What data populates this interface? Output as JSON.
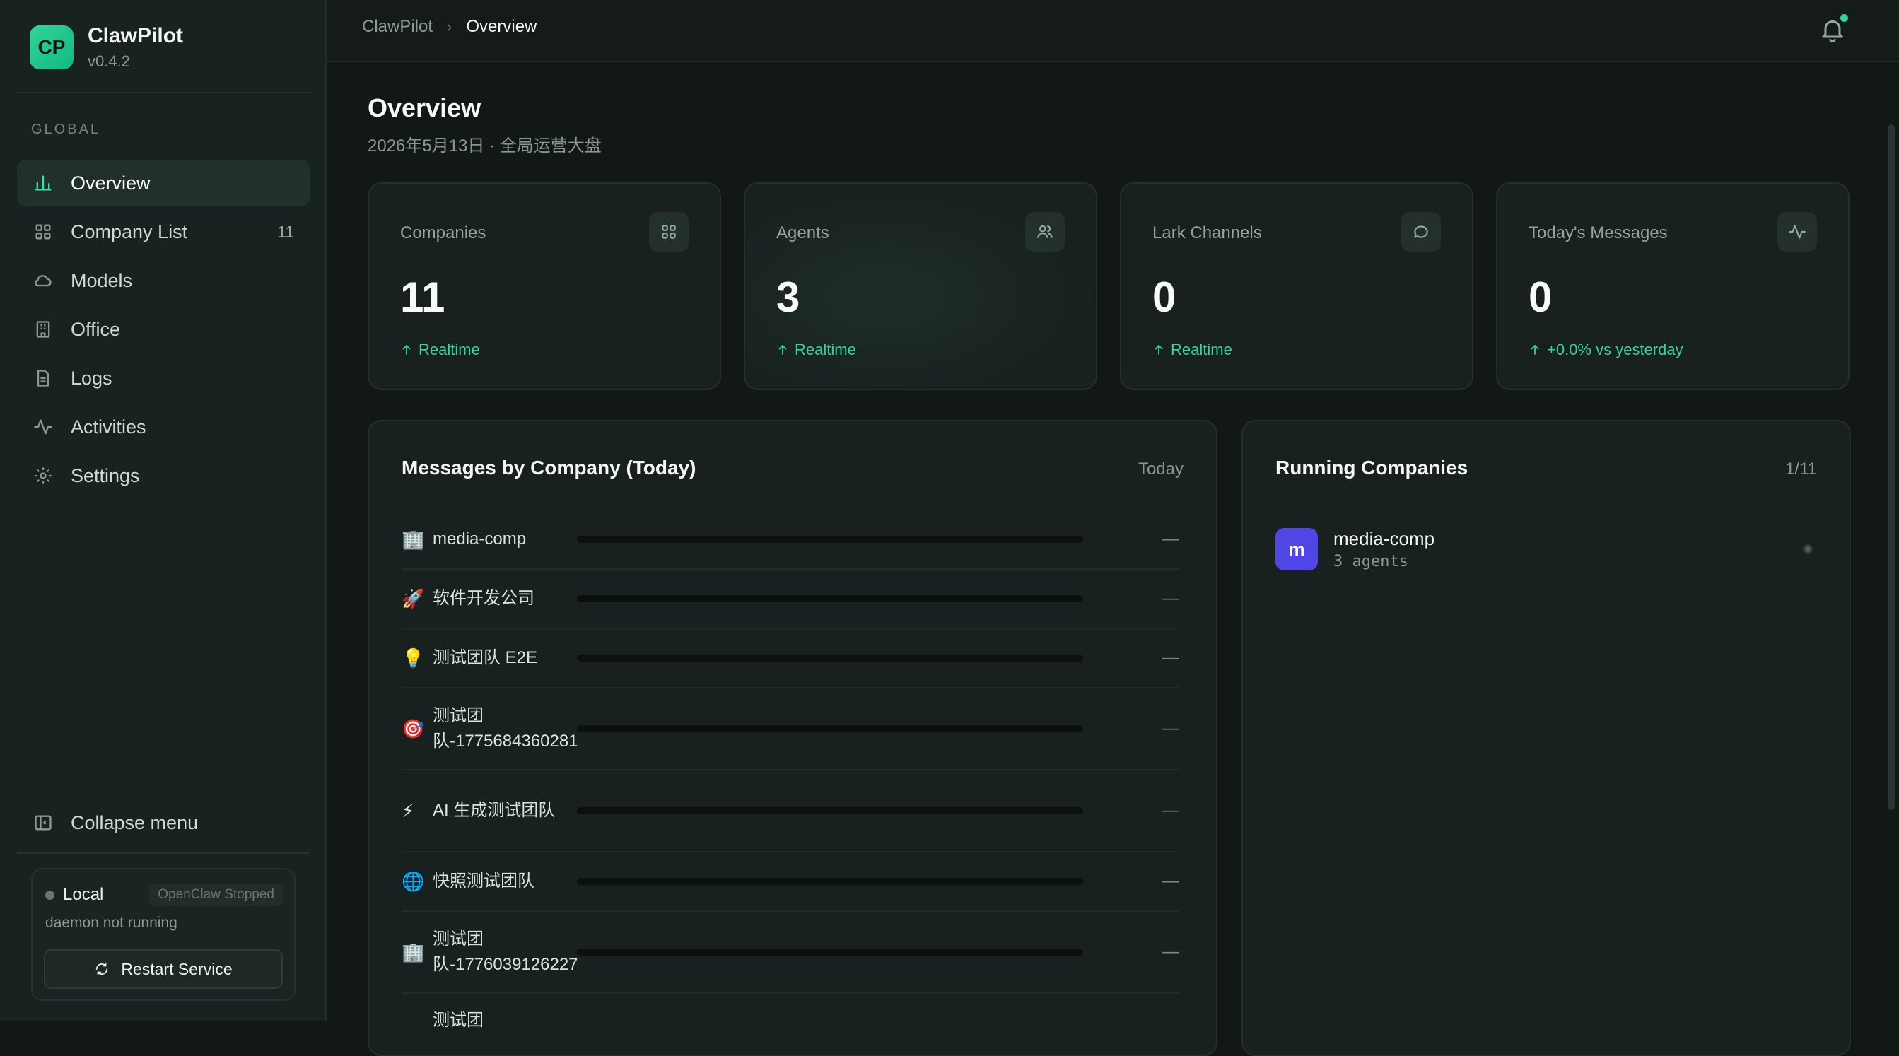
{
  "app": {
    "logo_text": "CP",
    "name": "ClawPilot",
    "version": "v0.4.2"
  },
  "sidebar": {
    "section_label": "GLOBAL",
    "items": [
      {
        "label": "Overview",
        "icon": "bar-chart-icon",
        "active": true,
        "count": ""
      },
      {
        "label": "Company List",
        "icon": "grid-icon",
        "active": false,
        "count": "11"
      },
      {
        "label": "Models",
        "icon": "cloud-icon",
        "active": false,
        "count": ""
      },
      {
        "label": "Office",
        "icon": "building-icon",
        "active": false,
        "count": ""
      },
      {
        "label": "Logs",
        "icon": "document-icon",
        "active": false,
        "count": ""
      },
      {
        "label": "Activities",
        "icon": "activity-icon",
        "active": false,
        "count": ""
      },
      {
        "label": "Settings",
        "icon": "gear-icon",
        "active": false,
        "count": ""
      }
    ],
    "collapse_label": "Collapse menu",
    "status": {
      "env_label": "Local",
      "badge": "OpenClaw Stopped",
      "detail": "daemon not running",
      "restart_label": "Restart Service"
    }
  },
  "topbar": {
    "breadcrumb_root": "ClawPilot",
    "breadcrumb_current": "Overview",
    "has_notification": true
  },
  "page": {
    "title": "Overview",
    "subtitle": "2026年5月13日 · 全局运营大盘"
  },
  "stats": [
    {
      "label": "Companies",
      "value": "11",
      "trend": "Realtime",
      "icon": "grid-icon"
    },
    {
      "label": "Agents",
      "value": "3",
      "trend": "Realtime",
      "icon": "users-icon"
    },
    {
      "label": "Lark Channels",
      "value": "0",
      "trend": "Realtime",
      "icon": "chat-icon"
    },
    {
      "label": "Today's Messages",
      "value": "0",
      "trend": "+0.0% vs yesterday",
      "icon": "activity-icon"
    }
  ],
  "messages_panel": {
    "title": "Messages by Company (Today)",
    "period": "Today",
    "rows": [
      {
        "emoji": "🏢",
        "name": "media-comp",
        "value": "—"
      },
      {
        "emoji": "🚀",
        "name": "软件开发公司",
        "value": "—"
      },
      {
        "emoji": "💡",
        "name": "测试团队 E2E",
        "value": "—"
      },
      {
        "emoji": "🎯",
        "name": "测试团队-1775684360281",
        "value": "—"
      },
      {
        "emoji": "⚡",
        "name": "AI 生成测试团队",
        "value": "—"
      },
      {
        "emoji": "🌐",
        "name": "快照测试团队",
        "value": "—"
      },
      {
        "emoji": "🏢",
        "name": "测试团队-1776039126227",
        "value": "—"
      },
      {
        "emoji": "",
        "name": "测试团",
        "value": ""
      }
    ]
  },
  "running_panel": {
    "title": "Running Companies",
    "count": "1/11",
    "companies": [
      {
        "initial": "m",
        "name": "media-comp",
        "agents": "3 agents",
        "avatar_color": "#5046e5"
      }
    ]
  },
  "colors": {
    "accent": "#34d399",
    "background": "#121816",
    "card": "#18211f"
  }
}
